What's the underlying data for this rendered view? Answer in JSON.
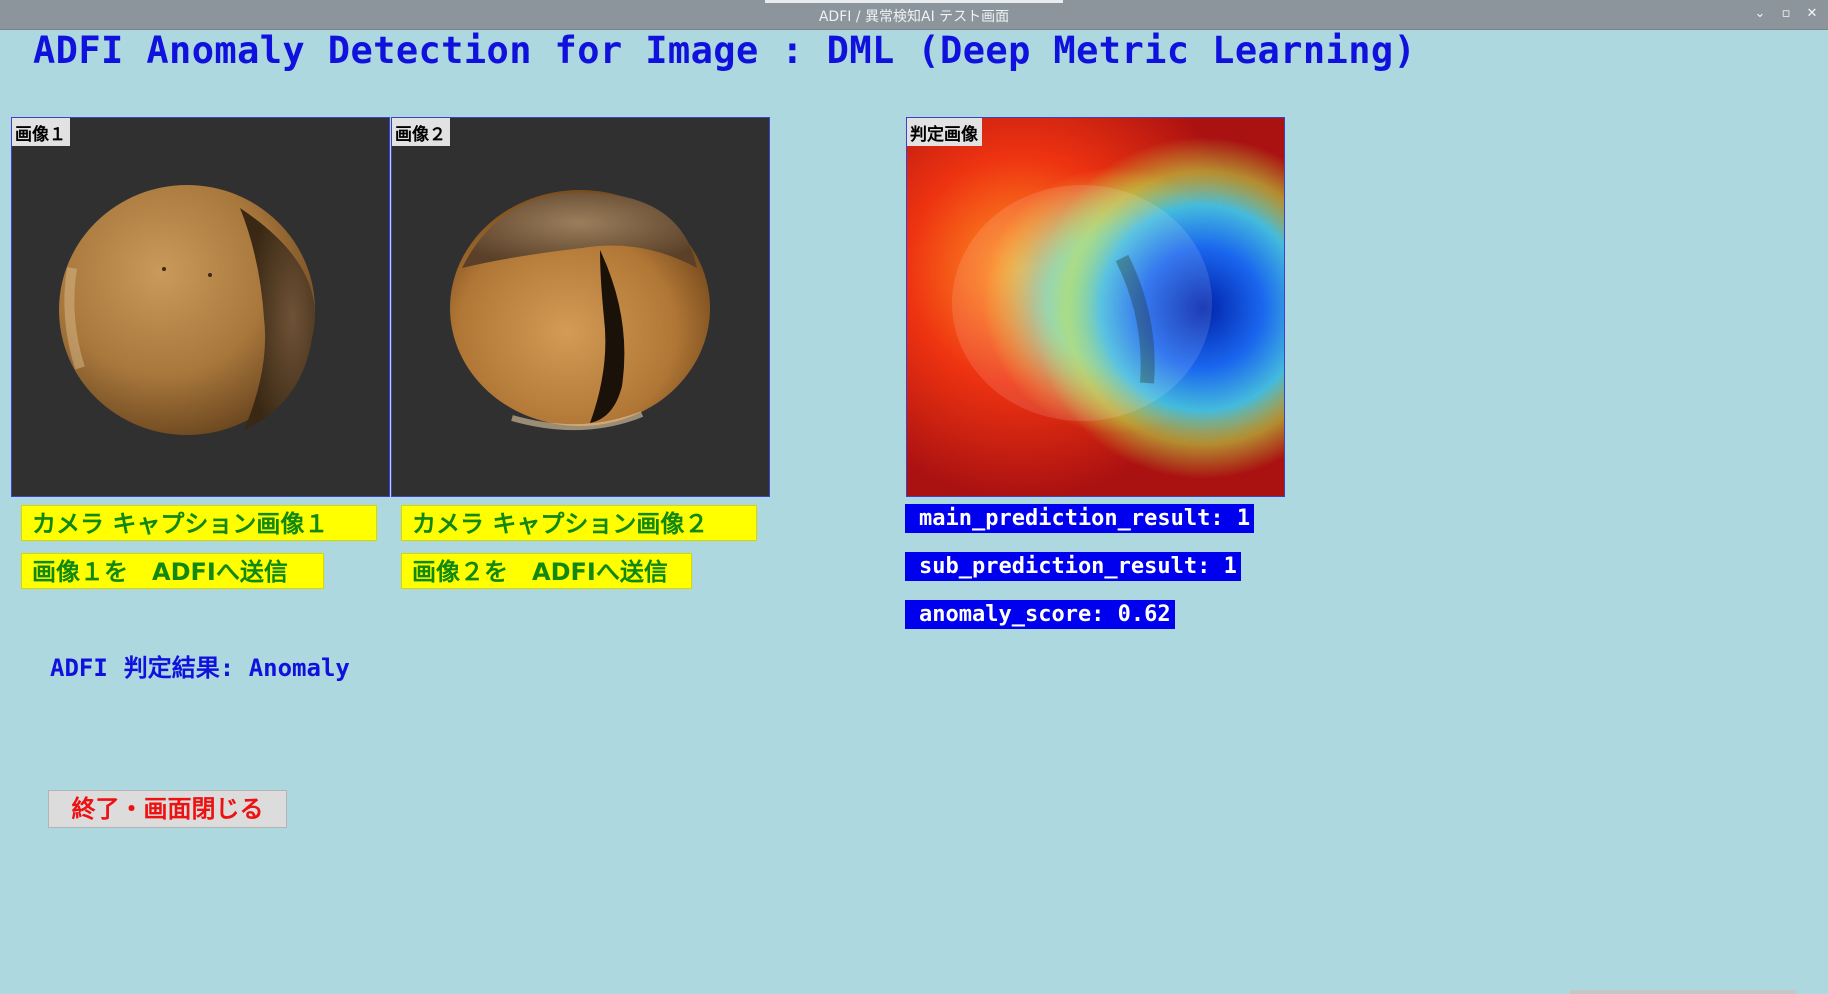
{
  "window": {
    "title": "ADFI / 異常検知AI テスト画面",
    "controls": [
      "⌄",
      "▫",
      "✕"
    ]
  },
  "header": {
    "title": "ADFI Anomaly Detection for Image : DML (Deep Metric Learning)"
  },
  "panels": {
    "image1": {
      "label": "画像１"
    },
    "image2": {
      "label": "画像２"
    },
    "judgment": {
      "label": "判定画像"
    }
  },
  "buttons": {
    "capture1": "カメラ キャプション画像１",
    "capture2": "カメラ キャプション画像２",
    "send1": "画像１を　ADFIへ送信",
    "send2": "画像２を　ADFIへ送信",
    "close": "終了・画面閉じる"
  },
  "result": {
    "prefix": "ADFI",
    "label": "判定結果: Anomaly"
  },
  "metrics": {
    "main_prediction": "main_prediction_result: 1",
    "sub_prediction": "sub_prediction_result: 1",
    "anomaly_score": "anomaly_score: 0.62"
  },
  "colors": {
    "background": "#add8e0",
    "title_blue": "#1111dd",
    "button_yellow": "#ffff00",
    "button_text_green": "#118811",
    "metric_bg": "#0000ee",
    "close_text": "#ee1111"
  }
}
